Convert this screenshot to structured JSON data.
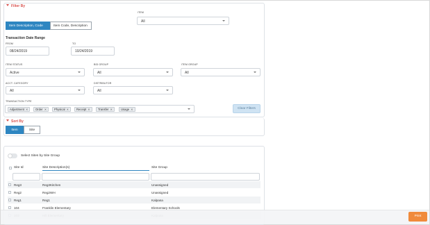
{
  "filter": {
    "title": "Filter By",
    "item_label": "ITEM",
    "item_value": "All",
    "mode_options": [
      "Item Description, Code",
      "Item Code, Description"
    ],
    "date_range_title": "Transaction Date Range",
    "from_label": "FROM",
    "from_value": "08/24/2019",
    "to_label": "TO",
    "to_value": "10/24/2019",
    "item_status_label": "ITEM STATUS",
    "item_status_value": "Active",
    "bid_group_label": "BID GROUP",
    "bid_group_value": "All",
    "item_group_label": "ITEM GROUP",
    "item_group_value": "All",
    "acct_category_label": "ACCT. CATEGORY",
    "acct_category_value": "All",
    "distributor_label": "DISTRIBUTOR",
    "distributor_value": "All",
    "transaction_type_label": "TRANSACTION TYPE",
    "transaction_types": [
      "Adjustment",
      "Order",
      "Physical",
      "Receipt",
      "Transfer",
      "Usage"
    ],
    "clear_button": "Clear Filters"
  },
  "sort": {
    "title": "Sort By",
    "options": [
      "Item",
      "Site"
    ]
  },
  "sites": {
    "toggle_label": "Select Sites by Site Group",
    "columns": [
      "Site Id",
      "Site Description(s)",
      "Site Group"
    ],
    "rows": [
      {
        "id": "Reg3",
        "desc": "Reg3Kitchen",
        "group": "Unassigned"
      },
      {
        "id": "Reg2",
        "desc": "Reg2WH",
        "group": "Unassigned"
      },
      {
        "id": "Reg1",
        "desc": "Reg1",
        "group": "Kalpana"
      },
      {
        "id": "104",
        "desc": "Franklin Elementary",
        "group": "Elementary Schools"
      },
      {
        "id": "103",
        "desc": "Hill Elementary",
        "group": "Kalpana"
      }
    ]
  },
  "footer": {
    "print_button": "Print"
  },
  "colors": {
    "accent": "#2e86c1",
    "section_title": "#d9534f",
    "print": "#f08a3b"
  }
}
